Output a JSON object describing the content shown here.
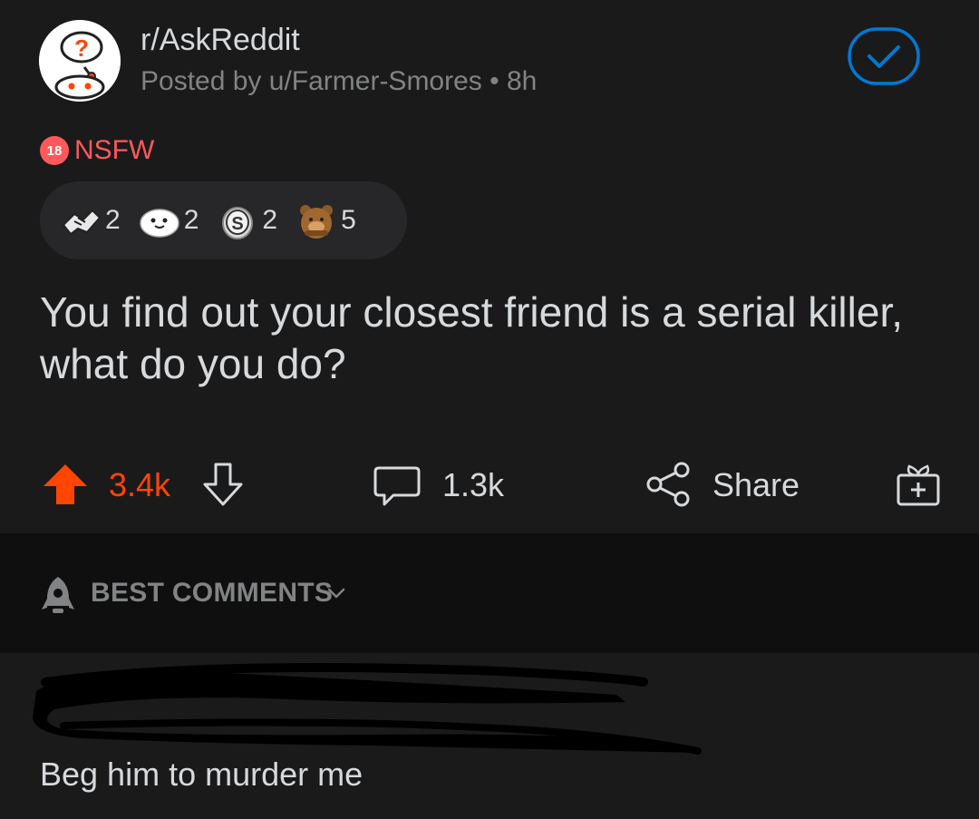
{
  "post": {
    "subreddit": "r/AskReddit",
    "posted_by": "Posted by u/Farmer-Smores • 8h",
    "nsfw_badge": "18",
    "nsfw_label": "NSFW",
    "title": "You find out your closest friend is a serial killer, what do you do?"
  },
  "awards": [
    {
      "icon": "handshake-award-icon",
      "count": "2"
    },
    {
      "icon": "wholesome-seal-award-icon",
      "count": "2"
    },
    {
      "icon": "silver-coin-award-icon",
      "count": "2"
    },
    {
      "icon": "bear-award-icon",
      "count": "5"
    }
  ],
  "actions": {
    "score": "3.4k",
    "comments": "1.3k",
    "share": "Share"
  },
  "sort": {
    "label": "BEST COMMENTS"
  },
  "comment": {
    "body": "Beg him to murder me"
  },
  "colors": {
    "background": "#1a1a1b",
    "accent_orange": "#ff4500",
    "nsfw_red": "#ff585b",
    "check_blue": "#0079d3",
    "text": "#d7dadc",
    "muted": "#818384"
  }
}
